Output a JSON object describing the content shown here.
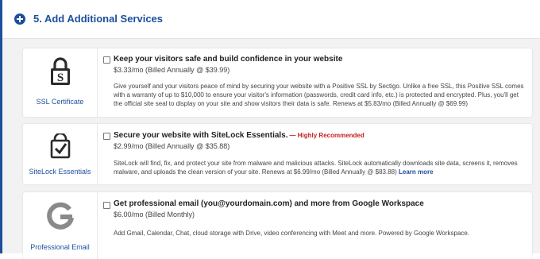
{
  "section": {
    "title": "5. Add Additional Services",
    "expand_icon": "plus-circle-icon"
  },
  "services": [
    {
      "label": "SSL Certificate",
      "icon": "ssl-lock-icon",
      "checked": false,
      "title": "Keep your visitors safe and build confidence in your website",
      "price": "$3.33/mo (Billed Annually @ $39.99)",
      "description": "Give yourself and your visitors peace of mind by securing your website with a Positive SSL by Sectigo. Unlike a free SSL, this Positive SSL comes with a warranty of up to $10,000 to ensure your visitor's information (passwords, credit card info, etc.) is protected and encrypted. Plus, you'll get the official site seal to display on your site and show visitors their data is safe. Renews at $5.83/mo (Billed Annually @ $69.99)"
    },
    {
      "label": "SiteLock Essentials",
      "icon": "sitelock-shield-check-icon",
      "checked": false,
      "title": "Secure your website with SiteLock Essentials.",
      "recommended": "— Highly Recommended",
      "price": "$2.99/mo (Billed Annually @ $35.88)",
      "description": "SiteLock will find, fix, and protect your site from malware and malicious attacks. SiteLock automatically downloads site data, screens it, removes malware, and uploads the clean version of your site. Renews at $6.99/mo (Billed Annually @ $83.88)",
      "link": "Learn more"
    },
    {
      "label": "Professional Email",
      "icon": "google-g-icon",
      "checked": false,
      "title": "Get professional email (you@yourdomain.com) and more from Google Workspace",
      "price": "$6.00/mo (Billed Monthly)",
      "description": "Add Gmail, Calendar, Chat, cloud storage with Drive, video conferencing with Meet and more. Powered by Google Workspace."
    }
  ],
  "colors": {
    "accent": "#1d4f9c",
    "recommended": "#c81e1e",
    "background": "#f2f2f2"
  }
}
